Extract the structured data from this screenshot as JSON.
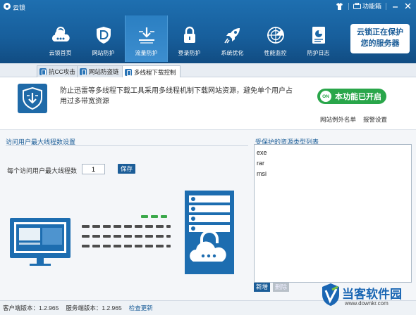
{
  "app": {
    "title": "云锁"
  },
  "titlebar": {
    "menu_label": "功能箱"
  },
  "nav": {
    "items": [
      {
        "label": "云锁首页",
        "icon": "cloud-lock-icon"
      },
      {
        "label": "网站防护",
        "icon": "shield-d-icon"
      },
      {
        "label": "流量防护",
        "icon": "traffic-arrow-icon"
      },
      {
        "label": "登录防护",
        "icon": "padlock-icon"
      },
      {
        "label": "系统优化",
        "icon": "rocket-icon"
      },
      {
        "label": "性能监控",
        "icon": "radar-icon"
      },
      {
        "label": "防护日志",
        "icon": "log-chart-icon"
      }
    ],
    "active_index": 2
  },
  "promo": {
    "line1": "云锁正在保护",
    "line2": "您的服务器"
  },
  "subtabs": [
    {
      "label": "抗CC攻击"
    },
    {
      "label": "网站防盗链"
    },
    {
      "label": "多线程下载控制"
    }
  ],
  "info": {
    "description": "防止迅雷等多线程下载工具采用多线程机制下载网站资源，避免单个用户占用过多带宽资源",
    "toggle_knob": "ON",
    "toggle_label": "本功能已开启",
    "link_exceptions": "网站例外名单",
    "link_alert": "报警设置"
  },
  "thread_settings": {
    "section_title": "访问用户最大线程数设置",
    "label": "每个访问用户最大线程数",
    "value": "1",
    "save_label": "保存"
  },
  "resources": {
    "title": "受保护的资源类型列表",
    "items": [
      "exe",
      "rar",
      "msi"
    ],
    "add_label": "新增",
    "delete_label": "删除"
  },
  "statusbar": {
    "client_version": "客户端版本：1.2.965",
    "server_version": "服务端版本：1.2.965",
    "check_update": "检查更新"
  },
  "watermark": {
    "text": "当客软件园",
    "url": "www.downkr.com"
  },
  "colors": {
    "brand_blue": "#1b5d98",
    "banner_blue": "#1a66a8",
    "toggle_green": "#29a64a"
  }
}
